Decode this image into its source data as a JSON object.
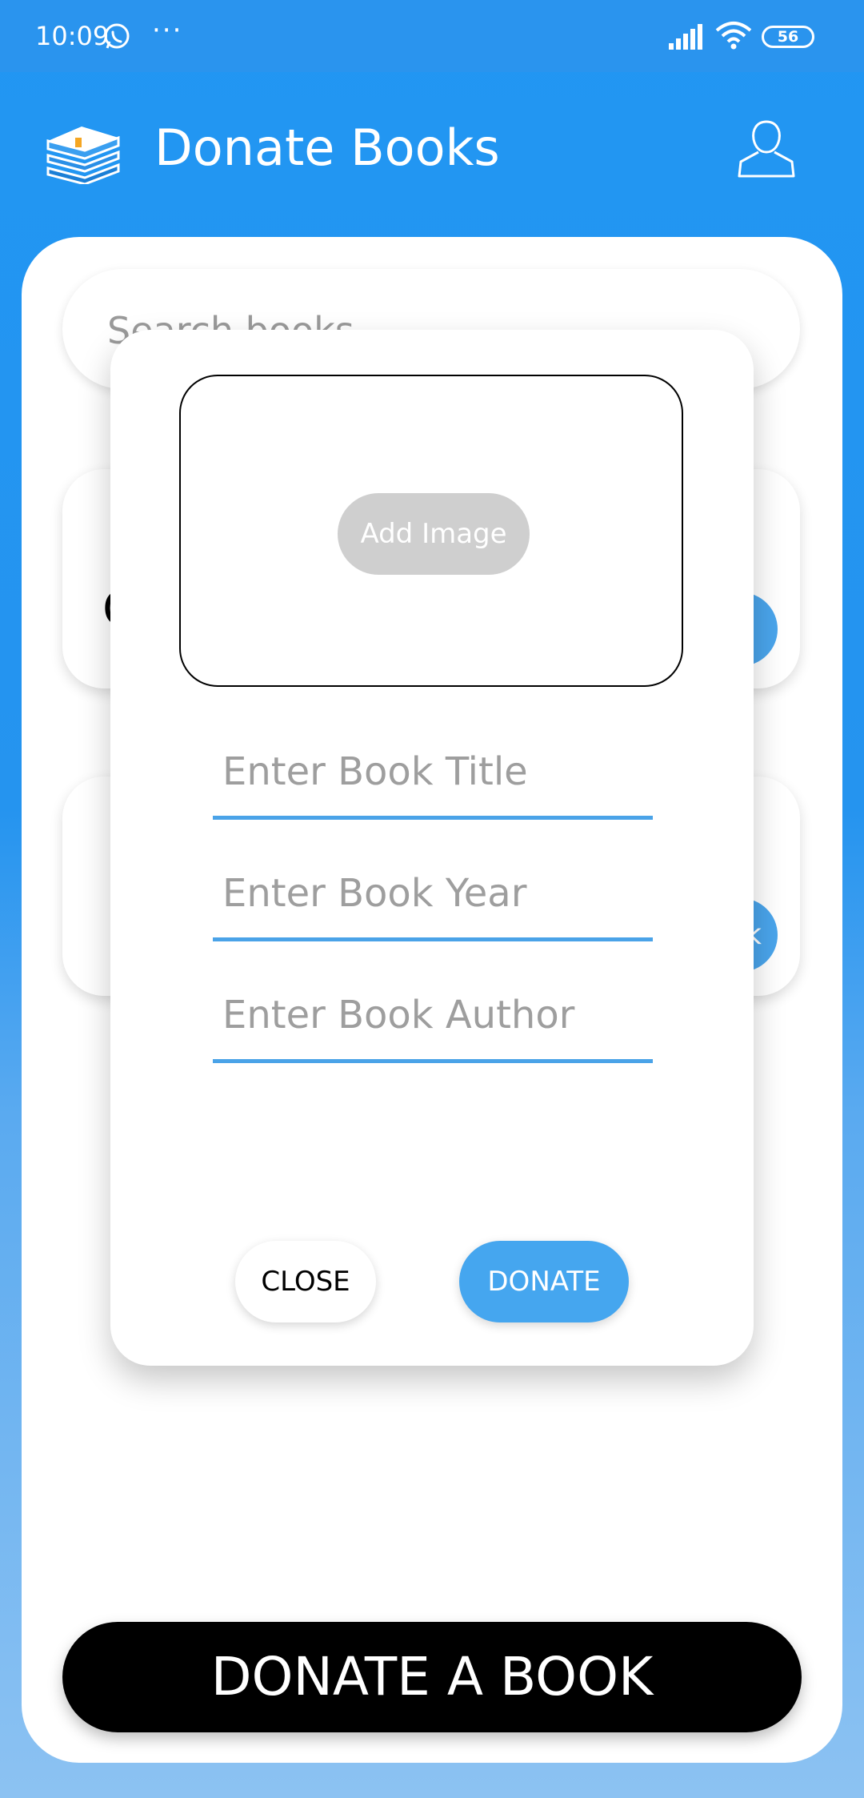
{
  "status_bar": {
    "time": "10:09",
    "more": "···",
    "battery": "56",
    "icons": [
      "whatsapp-icon",
      "signal-icon",
      "wifi-icon",
      "battery-icon"
    ]
  },
  "app_bar": {
    "title": "Donate Books",
    "logo_icon": "book-stack-icon",
    "profile_icon": "person-icon"
  },
  "search": {
    "placeholder": "Search books..."
  },
  "background_cards": {
    "card1_text": "G",
    "card2_button": "k"
  },
  "dialog": {
    "add_image_label": "Add Image",
    "title_placeholder": "Enter Book Title",
    "year_placeholder": "Enter Book Year",
    "author_placeholder": "Enter Book Author",
    "close_label": "CLOSE",
    "donate_label": "DONATE"
  },
  "footer": {
    "donate_a_book_label": "DONATE A BOOK"
  },
  "colors": {
    "primary_blue": "#2196f3",
    "accent_blue": "#45a6ef",
    "underline_blue": "#4aa3e8",
    "black": "#000000",
    "add_image_grey": "#cfcfcf"
  }
}
